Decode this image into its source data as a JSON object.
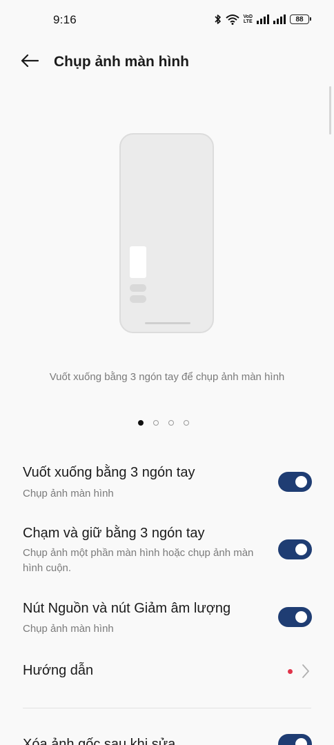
{
  "status_bar": {
    "time": "9:16",
    "battery": "88",
    "volte_top": "VoD",
    "volte_bottom": "LTE"
  },
  "header": {
    "title": "Chụp ảnh màn hình"
  },
  "illustration": {
    "caption": "Vuốt xuống bằng 3 ngón tay để chụp ảnh màn hình",
    "pages": 4,
    "active_page": 1
  },
  "settings": [
    {
      "title": "Vuốt xuống bằng 3 ngón tay",
      "subtitle": "Chụp ảnh màn hình",
      "enabled": true
    },
    {
      "title": "Chạm và giữ bằng 3 ngón tay",
      "subtitle": "Chụp ảnh một phần màn hình hoặc chụp ảnh màn hình cuộn.",
      "enabled": true
    },
    {
      "title": "Nút Nguồn và nút Giảm âm lượng",
      "subtitle": "Chụp ảnh màn hình",
      "enabled": true
    },
    {
      "title": "Hướng dẫn"
    },
    {
      "title": "Xóa ảnh gốc sau khi sửa",
      "enabled": true
    }
  ],
  "colors": {
    "toggle_on": "#1f3d73",
    "badge_dot": "#e0344a",
    "background": "#f9f9f9"
  }
}
